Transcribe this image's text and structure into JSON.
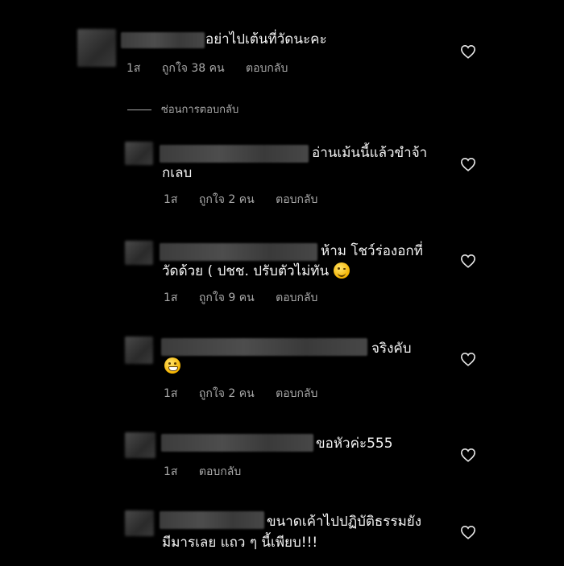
{
  "comments": [
    {
      "text_lines": [
        "อย่าไปเต้นที่วัดนะคะ"
      ],
      "time": "1ส",
      "likes": "ถูกใจ 38 คน",
      "reply": "ตอบกลับ"
    },
    {
      "text_lines": [
        "อ่านเม้นนี้แล้วขำจ้า",
        "กเลบ"
      ],
      "time": "1ส",
      "likes": "ถูกใจ 2 คน",
      "reply": "ตอบกลับ"
    },
    {
      "text_lines": [
        "ห้าม โชว์ร่องอกที่",
        "วัดด้วย ( ปชช. ปรับตัวไม่ทัน"
      ],
      "emoji": "winking-face",
      "time": "1ส",
      "likes": "ถูกใจ 9 คน",
      "reply": "ตอบกลับ"
    },
    {
      "text_lines": [
        "จริงคับ"
      ],
      "emoji": "grinning-face",
      "time": "1ส",
      "likes": "ถูกใจ 2 คน",
      "reply": "ตอบกลับ"
    },
    {
      "text_lines": [
        "ขอหัวค่ะ555"
      ],
      "time": "1ส",
      "reply": "ตอบกลับ"
    },
    {
      "text_lines": [
        "ขนาดเค้าไปปฏิบัติธรรมยัง",
        "มีมารเลย แถว ๆ นี้เพียบ!!!"
      ]
    }
  ],
  "hide_replies_label": "ซ่อนการตอบกลับ",
  "icons": {
    "like": "heart-outline-icon"
  }
}
